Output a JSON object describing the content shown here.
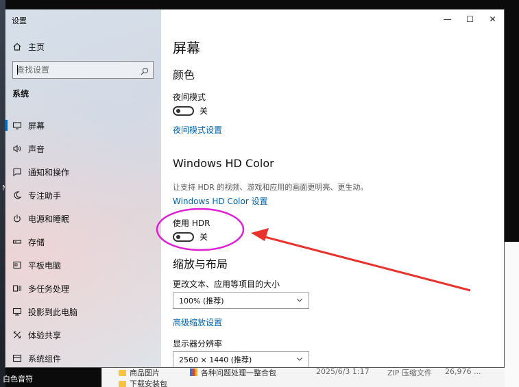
{
  "desktop": {
    "taskbar_label": "白色音符",
    "side_hint": "N",
    "explorer": {
      "folders": [
        "商品图片",
        "下载安装包"
      ],
      "file": {
        "name": "各种问题处理一整合包",
        "date": "2025/6/3 1:17",
        "type": "ZIP 压缩文件",
        "size": "26,976 ..."
      }
    }
  },
  "window": {
    "app_title": "设置",
    "controls": {
      "minimize": "—",
      "maximize": "☐",
      "close": "✕"
    }
  },
  "sidebar": {
    "home_label": "主页",
    "search_placeholder": "查找设置",
    "section_title": "系统",
    "items": [
      {
        "label": "屏幕",
        "icon": "monitor-icon",
        "active": true
      },
      {
        "label": "声音",
        "icon": "speaker-icon",
        "active": false
      },
      {
        "label": "通知和操作",
        "icon": "notification-icon",
        "active": false
      },
      {
        "label": "专注助手",
        "icon": "moon-icon",
        "active": false
      },
      {
        "label": "电源和睡眠",
        "icon": "power-icon",
        "active": false
      },
      {
        "label": "存储",
        "icon": "storage-icon",
        "active": false
      },
      {
        "label": "平板电脑",
        "icon": "tablet-icon",
        "active": false
      },
      {
        "label": "多任务处理",
        "icon": "multitask-icon",
        "active": false
      },
      {
        "label": "投影到此电脑",
        "icon": "project-icon",
        "active": false
      },
      {
        "label": "体验共享",
        "icon": "share-icon",
        "active": false
      },
      {
        "label": "系统组件",
        "icon": "components-icon",
        "active": false
      }
    ]
  },
  "main": {
    "page_title": "屏幕",
    "color_section": {
      "heading": "颜色",
      "night_mode_label": "夜间模式",
      "night_mode_state": "关",
      "night_mode_link": "夜间模式设置"
    },
    "hdr_section": {
      "heading": "Windows HD Color",
      "description": "让支持 HDR 的视频、游戏和应用的画面更明亮、更生动。",
      "settings_link": "Windows HD Color 设置",
      "use_hdr_label": "使用 HDR",
      "use_hdr_state": "关"
    },
    "layout_section": {
      "heading": "缩放与布局",
      "scale_label": "更改文本、应用等项目的大小",
      "scale_value": "100% (推荐)",
      "advanced_scaling_link": "高级缩放设置",
      "resolution_label": "显示器分辨率",
      "resolution_value": "2560 × 1440 (推荐)"
    }
  },
  "colors": {
    "accent": "#0067c0",
    "link": "#0063b1",
    "annotation_circle": "#e020d8",
    "annotation_arrow": "#e8322c"
  }
}
